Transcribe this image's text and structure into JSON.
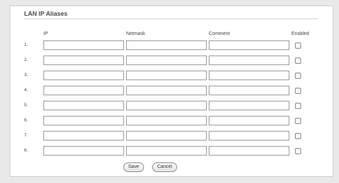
{
  "section": {
    "title": "LAN IP Aliases"
  },
  "columns": {
    "ip": "IP",
    "netmask": "Netmask",
    "comment": "Comment",
    "enabled": "Enabled"
  },
  "rows": [
    {
      "num": "1.",
      "ip": "",
      "netmask": "",
      "comment": "",
      "enabled": false
    },
    {
      "num": "2.",
      "ip": "",
      "netmask": "",
      "comment": "",
      "enabled": false
    },
    {
      "num": "3.",
      "ip": "",
      "netmask": "",
      "comment": "",
      "enabled": false
    },
    {
      "num": "4.",
      "ip": "",
      "netmask": "",
      "comment": "",
      "enabled": false
    },
    {
      "num": "5.",
      "ip": "",
      "netmask": "",
      "comment": "",
      "enabled": false
    },
    {
      "num": "6.",
      "ip": "",
      "netmask": "",
      "comment": "",
      "enabled": false
    },
    {
      "num": "7.",
      "ip": "",
      "netmask": "",
      "comment": "",
      "enabled": false
    },
    {
      "num": "8.",
      "ip": "",
      "netmask": "",
      "comment": "",
      "enabled": false
    }
  ],
  "buttons": {
    "save": "Save",
    "cancel": "Cancel"
  }
}
